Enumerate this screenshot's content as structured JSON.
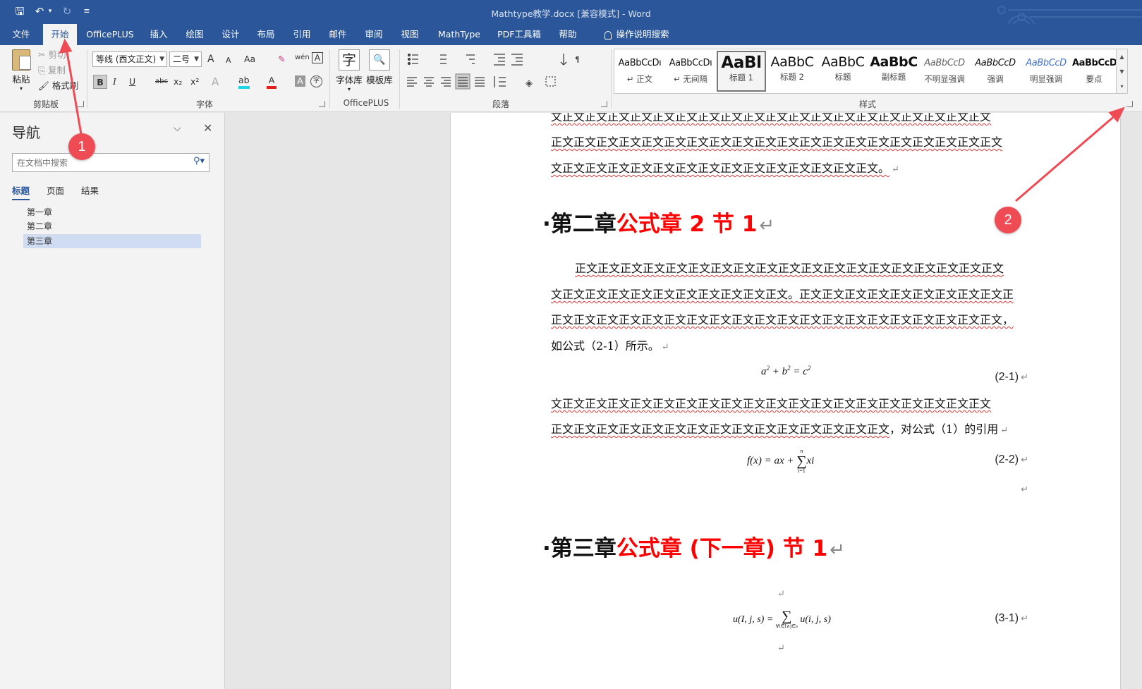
{
  "title_bar": {
    "doc_title": "Mathtype教学.docx [兼容模式]  -  Word",
    "qa_save": "🖫",
    "qa_undo": "↶",
    "qa_undo_dd": "▾",
    "qa_redo": "↻",
    "qa_customize": "≡"
  },
  "tabs": [
    "文件",
    "开始",
    "OfficePLUS",
    "插入",
    "绘图",
    "设计",
    "布局",
    "引用",
    "邮件",
    "审阅",
    "视图",
    "MathType",
    "PDF工具箱",
    "帮助",
    "操作说明搜索"
  ],
  "ribbon": {
    "clipboard": {
      "paste": "粘贴",
      "cut": "剪切",
      "copy": "复制",
      "format_painter": "格式刷",
      "group": "剪贴板"
    },
    "font": {
      "font_name": "等线 (西文正文)",
      "font_size": "二号",
      "group": "字体",
      "grow": "A",
      "shrink": "A",
      "case": "Aa",
      "clear": "✎",
      "phonetic": "wén",
      "border_a": "A",
      "bold": "B",
      "italic": "I",
      "underline": "U",
      "strike": "abc",
      "sub": "x₂",
      "sup": "x²",
      "effects": "A",
      "highlight": "ab",
      "color": "A",
      "shade": "A",
      "encircle": "字"
    },
    "officeplus": {
      "char_lib": "字体库",
      "template_lib": "模板库",
      "group": "OfficePLUS"
    },
    "paragraph": {
      "group": "段落"
    },
    "styles": {
      "group": "样式",
      "items": [
        {
          "sample": "AaBbCcDı",
          "name": "↵ 正文"
        },
        {
          "sample": "AaBbCcDı",
          "name": "↵ 无间隔"
        },
        {
          "sample": "AaBl",
          "name": "标题 1"
        },
        {
          "sample": "AaBbC",
          "name": "标题 2"
        },
        {
          "sample": "AaBbC",
          "name": "标题"
        },
        {
          "sample": "AaBbC",
          "name": "副标题"
        },
        {
          "sample": "AaBbCcD",
          "name": "不明显强调"
        },
        {
          "sample": "AaBbCcD",
          "name": "强调"
        },
        {
          "sample": "AaBbCcD",
          "name": "明显强调"
        },
        {
          "sample": "AaBbCcD",
          "name": "要点"
        }
      ]
    }
  },
  "nav": {
    "title": "导航",
    "search_placeholder": "在文档中搜索",
    "tabs": [
      "标题",
      "页面",
      "结果"
    ],
    "headings": [
      "第一章",
      "第二章",
      "第三章"
    ]
  },
  "document": {
    "p1": [
      "文正文正文正文正文正文正文正文正文正文正文正文正文正文正文正文正文正文正文正文",
      "正文正文正文正文正文正文正文正文正文正文正文正文正文正文正文正文正文正文正文正文",
      "文正文正文正文正文正文正文正文正文正文正文正文正文正文正文。"
    ],
    "ch2_black": "·第二章",
    "ch2_red": "公式章 2 节 1",
    "p2": [
      "正文正文正文正文正文正文正文正文正文正文正文正文正文正文正文正文正文正文正文",
      "文正文正文正文正文正文正文正文正文正文正文。",
      "正文正文正文正文正文正文正文正文正文正文正文正文正文正文正文正文正文正文正文正文，",
      "如公式（2-1）所示。"
    ],
    "p2_line2_extra": "正文正文正文正文正文正文正文正文正文正",
    "eq1_num": "(2-1)",
    "p3": [
      "文正文正文正文正文正文正文正文正文正文正文正文正文正文正文正文正文正文正文正文",
      "正文正文正文正文正文正文正文正文正文正文正文正文正文正文正文"
    ],
    "p3_tail": "，对公式（1）的引用",
    "eq2_num": "(2-2)",
    "ch3_black": "·第三章",
    "ch3_red": "公式章 (下一章) 节 1",
    "eq3_num": "(3-1)",
    "return_mark": "↵"
  },
  "callouts": {
    "one": "1",
    "two": "2"
  },
  "colors": {
    "title_bar": "#2b579a",
    "heading_red": "#ff0000",
    "callout": "#ef4b55"
  }
}
